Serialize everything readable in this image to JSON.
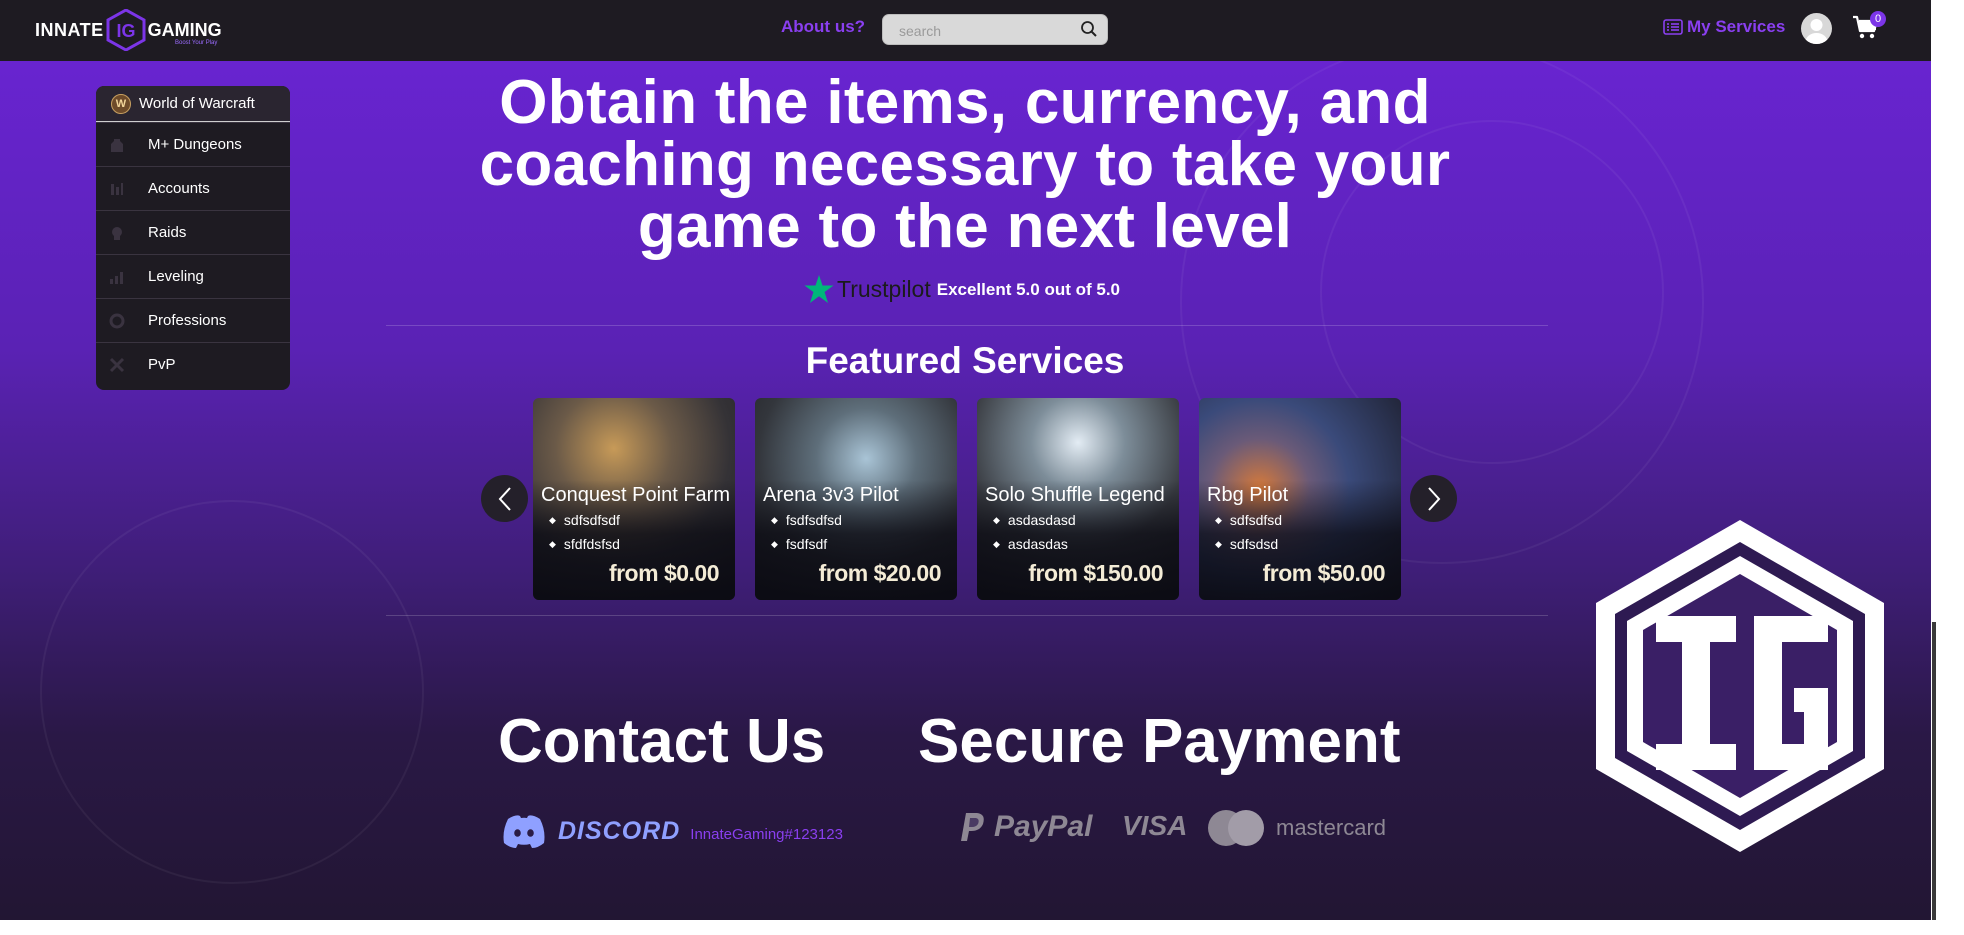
{
  "header": {
    "logo_left": "INNATE",
    "logo_right": "GAMING",
    "logo_tagline": "Boost Your Play",
    "about": "About us?",
    "search_placeholder": "search",
    "my_services": "My Services",
    "cart_count": "0"
  },
  "sidebar": {
    "game": "World of Warcraft",
    "items": [
      {
        "label": "M+ Dungeons",
        "icon": "dungeon-icon"
      },
      {
        "label": "Accounts",
        "icon": "accounts-icon"
      },
      {
        "label": "Raids",
        "icon": "raid-icon"
      },
      {
        "label": "Leveling",
        "icon": "leveling-icon"
      },
      {
        "label": "Professions",
        "icon": "professions-icon"
      },
      {
        "label": "PvP",
        "icon": "pvp-icon"
      }
    ]
  },
  "hero": {
    "line1": "Obtain the items, currency, and",
    "line2": "coaching necessary to take your",
    "line3": "game to the next level"
  },
  "trustpilot": {
    "brand": "Trustpilot",
    "rating_text": "Excellent 5.0 out of 5.0"
  },
  "featured": {
    "title": "Featured Services",
    "cards": [
      {
        "title": "Conquest Point Farm",
        "bullets": [
          "sdfsdfsdf",
          "sfdfdsfsd"
        ],
        "price": "from $0.00"
      },
      {
        "title": "Arena 3v3 Pilot",
        "bullets": [
          "fsdfsdfsd",
          "fsdfsdf"
        ],
        "price": "from $20.00"
      },
      {
        "title": "Solo Shuffle Legend",
        "bullets": [
          "asdasdasd",
          "asdasdas"
        ],
        "price": "from $150.00"
      },
      {
        "title": "Rbg Pilot",
        "bullets": [
          "sdfsdfsd",
          "sdfsdsd"
        ],
        "price": "from $50.00"
      }
    ]
  },
  "contact": {
    "title": "Contact Us",
    "discord_word": "DISCORD",
    "discord_tag": "InnateGaming#123123"
  },
  "payment": {
    "title": "Secure Payment",
    "paypal": "PayPal",
    "visa": "VISA",
    "mastercard": "mastercard"
  },
  "colors": {
    "accent": "#8a3ff0",
    "topbar": "#1e1b22",
    "bg_top": "#6b24d6",
    "bg_bottom": "#221633"
  }
}
